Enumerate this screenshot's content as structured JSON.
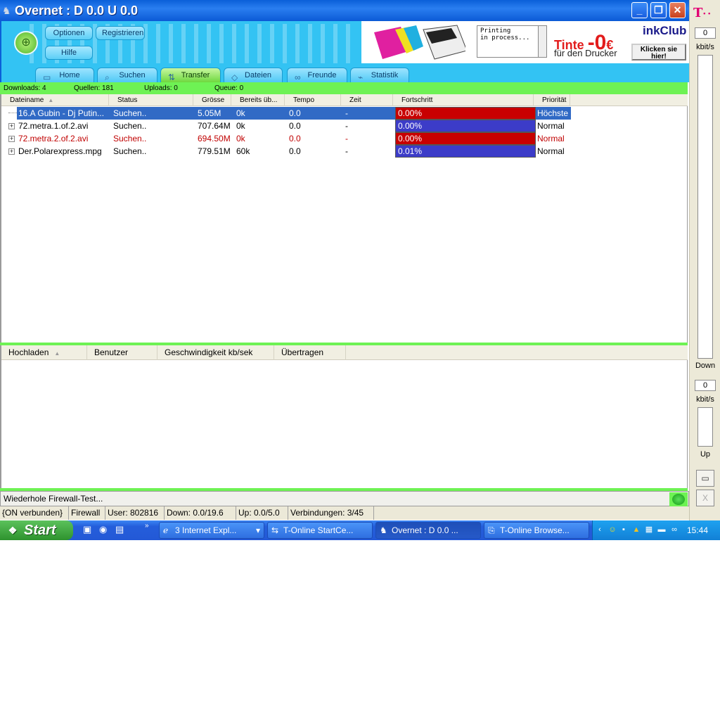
{
  "window": {
    "title": "Overnet : D 0.0 U 0.0",
    "controls": [
      "_",
      "❐",
      "✕"
    ]
  },
  "header": {
    "buttons": {
      "options": "Optionen",
      "register": "Registrieren",
      "help": "Hilfe"
    },
    "ad": {
      "printing": "Printing\nin process...",
      "tinte": "Tinte",
      "price": "-0",
      "currency": "€",
      "subline": "für den Drucker",
      "brand": "inkClub",
      "cta": "Klicken sie hier!"
    },
    "tabs": [
      {
        "label": "Home",
        "icon": "home-icon"
      },
      {
        "label": "Suchen",
        "icon": "search-icon"
      },
      {
        "label": "Transfer",
        "icon": "transfer-icon",
        "active": true
      },
      {
        "label": "Dateien",
        "icon": "files-icon"
      },
      {
        "label": "Freunde",
        "icon": "friends-icon"
      },
      {
        "label": "Statistik",
        "icon": "chart-icon"
      }
    ]
  },
  "stats": {
    "downloads": "Downloads: 4",
    "sources": "Quellen: 181",
    "uploads": "Uploads: 0",
    "queue": "Queue: 0"
  },
  "downloads": {
    "columns": [
      "Dateiname",
      "Status",
      "Grösse",
      "Bereits üb...",
      "Tempo",
      "Zeit",
      "Fortschritt",
      "Priorität"
    ],
    "rows": [
      {
        "name": "16.A Gubin - Dj Putin...",
        "status": "Suchen..",
        "size": "5.05M",
        "transferred": "0k",
        "speed": "0.0",
        "time": "-",
        "progress": "0.00%",
        "progress_color": "#c80000",
        "priority": "Höchste",
        "selected": true,
        "red": false
      },
      {
        "name": "72.metra.1.of.2.avi",
        "status": "Suchen..",
        "size": "707.64M",
        "transferred": "0k",
        "speed": "0.0",
        "time": "-",
        "progress": "0.00%",
        "progress_color": "#3c3cc8",
        "priority": "Normal",
        "selected": false,
        "red": false
      },
      {
        "name": "72.metra.2.of.2.avi",
        "status": "Suchen..",
        "size": "694.50M",
        "transferred": "0k",
        "speed": "0.0",
        "time": "-",
        "progress": "0.00%",
        "progress_color": "#c80000",
        "priority": "Normal",
        "selected": false,
        "red": true
      },
      {
        "name": "Der.Polarexpress.mpg",
        "status": "Suchen..",
        "size": "779.51M",
        "transferred": "60k",
        "speed": "0.0",
        "time": "-",
        "progress": "0.01%",
        "progress_color": "#3c3cc8",
        "priority": "Normal",
        "selected": false,
        "red": false
      }
    ]
  },
  "uploads": {
    "columns": [
      "Hochladen",
      "Benutzer",
      "Geschwindigkeit kb/sek",
      "Übertragen"
    ]
  },
  "firewall": {
    "text": "Wiederhole Firewall-Test..."
  },
  "statusbar": {
    "connection": "{ON verbunden}",
    "firewall": "Firewall",
    "user": "User: 802816",
    "down": "Down: 0.0/19.6",
    "up": "Up: 0.0/5.0",
    "connections": "Verbindungen: 3/45"
  },
  "side": {
    "down_value": "0",
    "down_unit": "kbit/s",
    "down_label": "Down",
    "up_value": "0",
    "up_unit": "kbit/s",
    "up_label": "Up"
  },
  "taskbar": {
    "start": "Start",
    "tasks": [
      "3 Internet Expl...",
      "T-Online StartCe...",
      "Overnet : D 0.0 ...",
      "T-Online Browse..."
    ],
    "clock": "15:44"
  }
}
